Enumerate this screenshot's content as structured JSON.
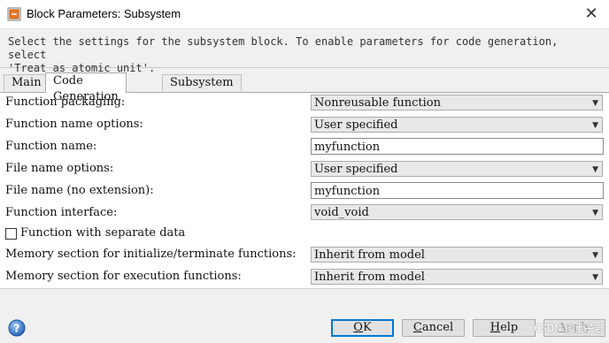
{
  "window": {
    "title": "Block Parameters: Subsystem"
  },
  "description": "Select the settings for the subsystem block. To enable parameters for code generation, select\n'Treat as atomic unit'.",
  "tabs": [
    {
      "label": "Main"
    },
    {
      "label": "Code Generation"
    },
    {
      "label": "Subsystem Reference"
    }
  ],
  "fields": {
    "function_packaging": {
      "label": "Function packaging:",
      "value": "Nonreusable function"
    },
    "function_name_options": {
      "label": "Function name options:",
      "value": "User specified"
    },
    "function_name": {
      "label": "Function name:",
      "value": "myfunction"
    },
    "file_name_options": {
      "label": "File name options:",
      "value": "User specified"
    },
    "file_name": {
      "label": "File name (no extension):",
      "value": "myfunction"
    },
    "function_interface": {
      "label": "Function interface:",
      "value": "void_void"
    },
    "separate_data": {
      "label": "Function with separate data",
      "checked": false
    },
    "memory_init": {
      "label": "Memory section for initialize/terminate functions:",
      "value": "Inherit from model"
    },
    "memory_exec": {
      "label": "Memory section for execution functions:",
      "value": "Inherit from model"
    }
  },
  "buttons": {
    "ok": {
      "first": "O",
      "rest": "K"
    },
    "cancel": {
      "first": "C",
      "rest": "ancel"
    },
    "help": {
      "first": "H",
      "rest": "elp"
    },
    "apply": {
      "first": "A",
      "rest": "pply"
    }
  },
  "watermark": "CSDN @重子岩",
  "colors": {
    "accent": "#0078d7",
    "panel": "#ffffff",
    "chrome": "#f0f0f0"
  }
}
